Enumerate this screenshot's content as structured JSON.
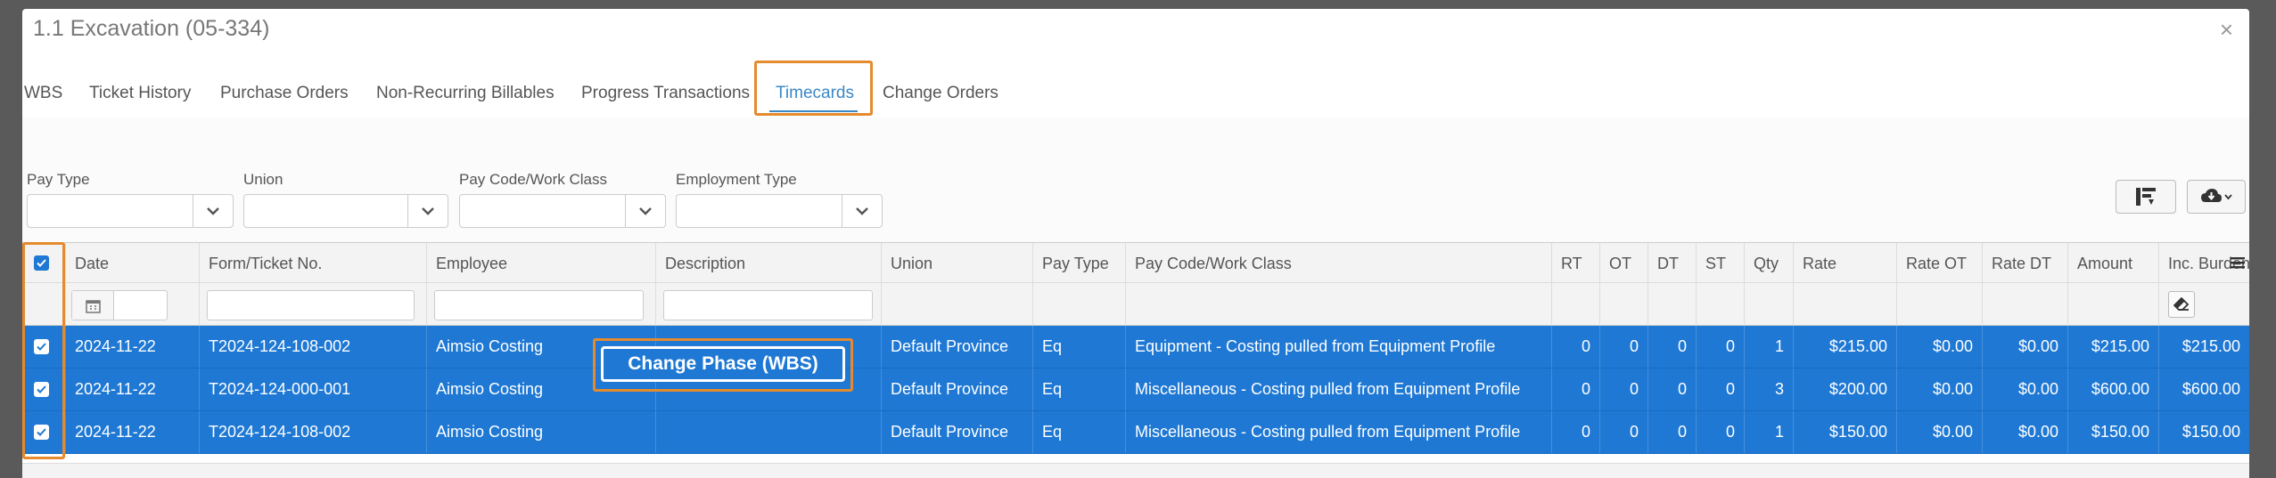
{
  "modal": {
    "title": "1.1 Excavation (05-334)",
    "close": "×"
  },
  "tabs": [
    "WBS",
    "Ticket History",
    "Purchase Orders",
    "Non-Recurring Billables",
    "Progress Transactions",
    "Timecards",
    "Change Orders"
  ],
  "active_tab": "Timecards",
  "filters": {
    "pay_type": {
      "label": "Pay Type",
      "value": ""
    },
    "union": {
      "label": "Union",
      "value": ""
    },
    "pay_code": {
      "label": "Pay Code/Work Class",
      "value": ""
    },
    "employment_type": {
      "label": "Employment Type",
      "value": ""
    }
  },
  "columns": [
    "Date",
    "Form/Ticket No.",
    "Employee",
    "Description",
    "Union",
    "Pay Type",
    "Pay Code/Work Class",
    "RT",
    "OT",
    "DT",
    "ST",
    "Qty",
    "Rate",
    "Rate OT",
    "Rate DT",
    "Amount",
    "Inc. Burden"
  ],
  "rows": [
    {
      "date": "2024-11-22",
      "ticket": "T2024-124-108-002",
      "employee": "Aimsio Costing",
      "description": "",
      "union": "Default Province",
      "pay_type": "Eq",
      "pay_code": "Equipment - Costing pulled from Equipment Profile",
      "rt": "0",
      "ot": "0",
      "dt": "0",
      "st": "0",
      "qty": "1",
      "rate": "$215.00",
      "rate_ot": "$0.00",
      "rate_dt": "$0.00",
      "amount": "$215.00",
      "burden": "$215.00"
    },
    {
      "date": "2024-11-22",
      "ticket": "T2024-124-000-001",
      "employee": "Aimsio Costing",
      "description": "",
      "union": "Default Province",
      "pay_type": "Eq",
      "pay_code": "Miscellaneous - Costing pulled from Equipment Profile",
      "rt": "0",
      "ot": "0",
      "dt": "0",
      "st": "0",
      "qty": "3",
      "rate": "$200.00",
      "rate_ot": "$0.00",
      "rate_dt": "$0.00",
      "amount": "$600.00",
      "burden": "$600.00"
    },
    {
      "date": "2024-11-22",
      "ticket": "T2024-124-108-002",
      "employee": "Aimsio Costing",
      "description": "",
      "union": "Default Province",
      "pay_type": "Eq",
      "pay_code": "Miscellaneous - Costing pulled from Equipment Profile",
      "rt": "0",
      "ot": "0",
      "dt": "0",
      "st": "0",
      "qty": "1",
      "rate": "$150.00",
      "rate_ot": "$0.00",
      "rate_dt": "$0.00",
      "amount": "$150.00",
      "burden": "$150.00"
    }
  ],
  "context_button": "Change Phase (WBS)",
  "icons": {
    "close": "close-icon",
    "chevron": "chevron-down-icon",
    "column_chooser": "column-chooser-icon",
    "export": "cloud-download-icon",
    "calendar": "calendar-icon",
    "eraser": "eraser-icon",
    "menu": "hamburger-menu-icon",
    "check": "checkmark-icon"
  },
  "colors": {
    "accent": "#3a87c7",
    "selection": "#1e78d4",
    "highlight": "#e58a2d"
  }
}
